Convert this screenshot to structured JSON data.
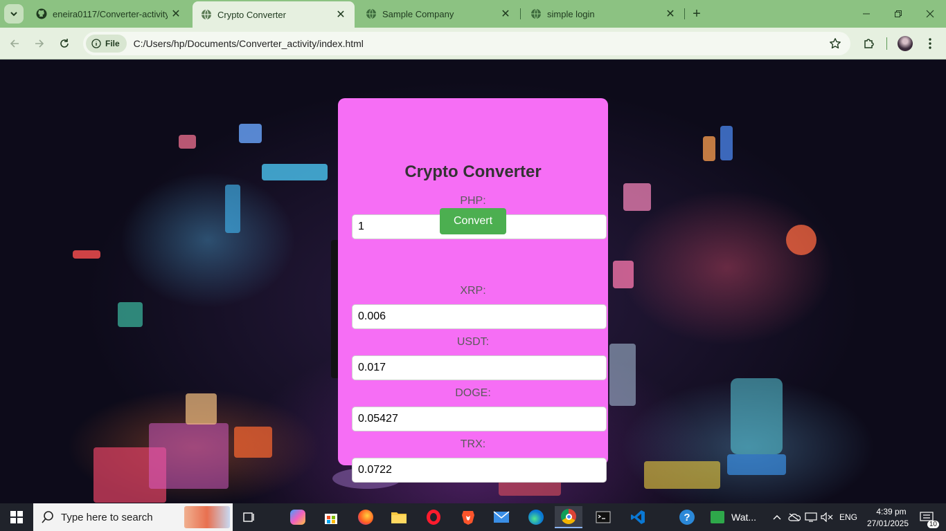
{
  "browser": {
    "tabs": [
      {
        "title": "eneira0117/Converter-activity",
        "favicon": "github-icon",
        "active": false
      },
      {
        "title": "Crypto Converter",
        "favicon": "globe-icon",
        "active": true
      },
      {
        "title": "Sample Company",
        "favicon": "globe-icon",
        "active": false
      },
      {
        "title": "simple login",
        "favicon": "globe-icon",
        "active": false
      }
    ],
    "address": {
      "chip_label": "File",
      "url": "C:/Users/hp/Documents/Converter_activity/index.html"
    },
    "colors": {
      "frame": "#8cc282",
      "toolbar": "#e6f0e0"
    }
  },
  "converter": {
    "title": "Crypto Converter",
    "php_label": "PHP:",
    "php_value": "1",
    "convert_label": "Convert",
    "results": [
      {
        "label": "XRP:",
        "value": "0.006"
      },
      {
        "label": "USDT:",
        "value": "0.017"
      },
      {
        "label": "DOGE:",
        "value": "0.05427"
      },
      {
        "label": "TRX:",
        "value": "0.0722"
      }
    ],
    "colors": {
      "card": "#f66ef5",
      "button": "#4caf50"
    }
  },
  "taskbar": {
    "search_placeholder": "Type here to search",
    "pinned_watch_label": "Wat...",
    "language": "ENG",
    "time": "4:39 pm",
    "date": "27/01/2025",
    "notification_count": "10"
  }
}
